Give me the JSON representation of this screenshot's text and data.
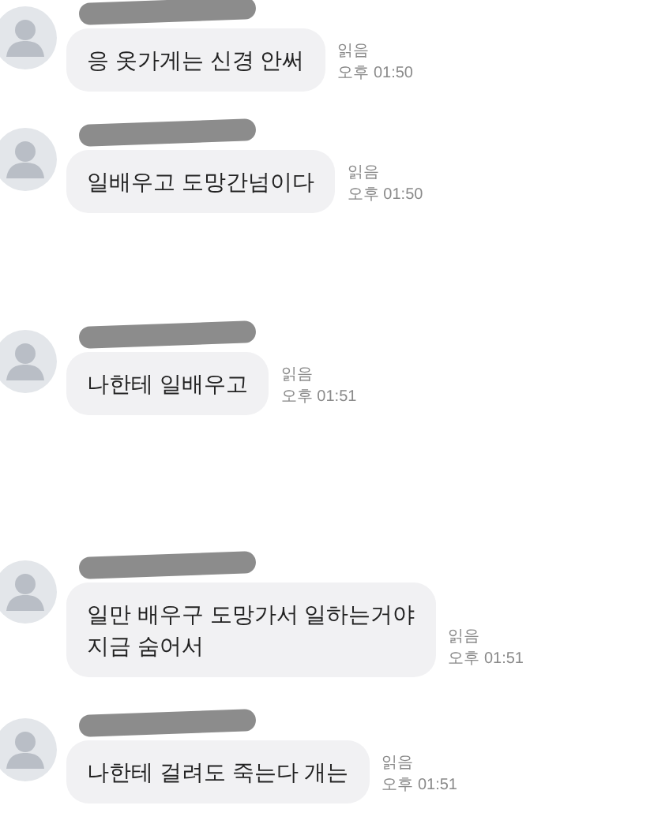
{
  "messages": [
    {
      "text": "응 옷가게는 신경 안써",
      "read_label": "읽음",
      "time": "오후 01:50"
    },
    {
      "text": "일배우고 도망간넘이다",
      "read_label": "읽음",
      "time": "오후 01:50"
    },
    {
      "text": "나한테 일배우고",
      "read_label": "읽음",
      "time": "오후 01:51"
    },
    {
      "text": "일만 배우구 도망가서 일하는거야\n지금 숨어서",
      "read_label": "읽음",
      "time": "오후 01:51"
    },
    {
      "text": "나한테 걸려도 죽는다 개는",
      "read_label": "읽음",
      "time": "오후 01:51"
    }
  ]
}
